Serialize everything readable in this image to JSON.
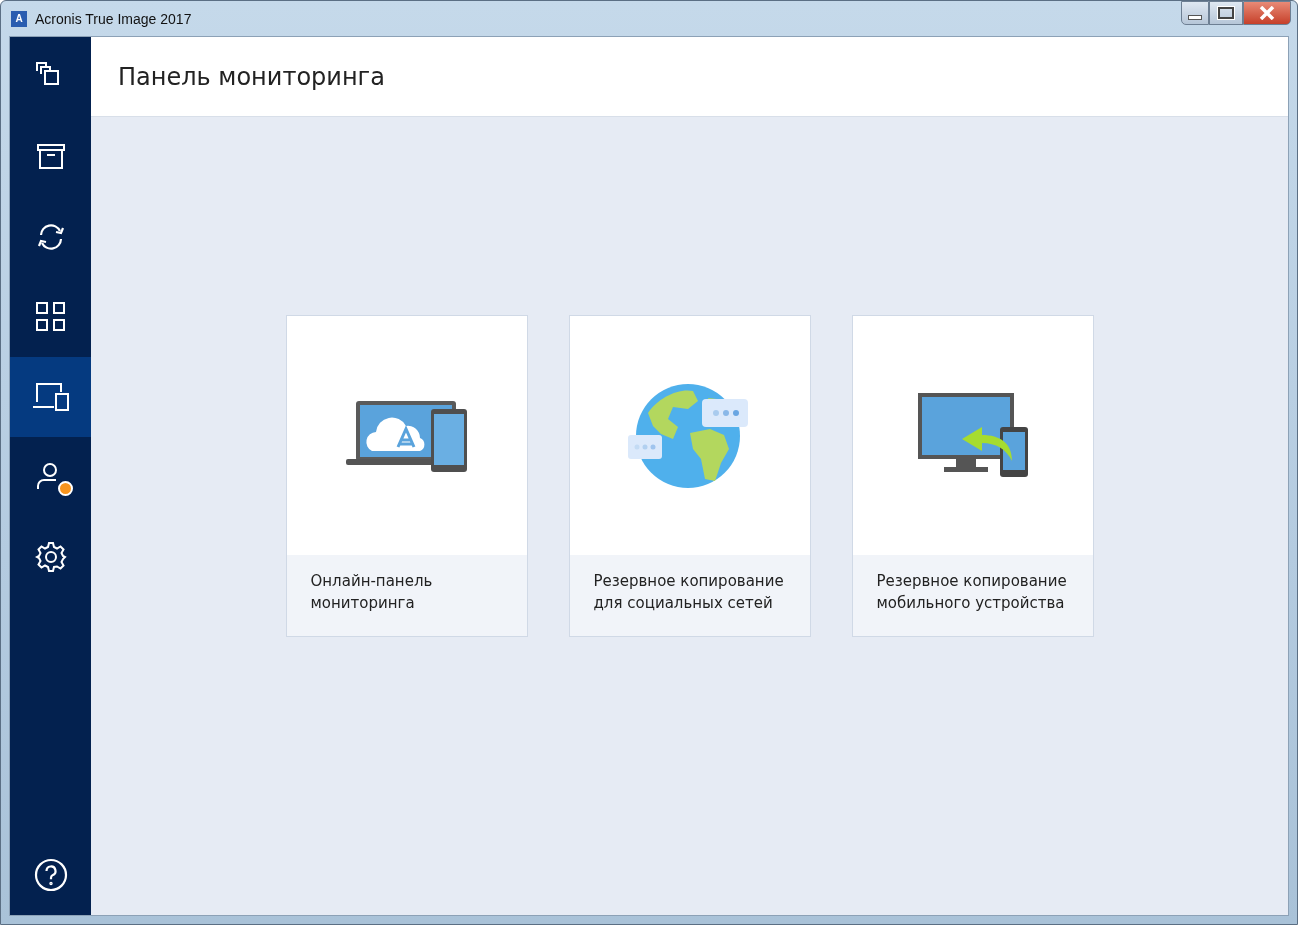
{
  "window": {
    "title": "Acronis True Image 2017",
    "icon_letter": "A"
  },
  "sidebar": {
    "items": [
      {
        "kind": "copies",
        "selected": false,
        "notification": false
      },
      {
        "kind": "archive",
        "selected": false,
        "notification": false
      },
      {
        "kind": "sync",
        "selected": false,
        "notification": false
      },
      {
        "kind": "grid",
        "selected": false,
        "notification": false
      },
      {
        "kind": "devices",
        "selected": true,
        "notification": false
      },
      {
        "kind": "account",
        "selected": false,
        "notification": true
      },
      {
        "kind": "settings",
        "selected": false,
        "notification": false
      }
    ],
    "bottom_item": {
      "kind": "help",
      "selected": false
    }
  },
  "header": {
    "title": "Панель мониторинга"
  },
  "cards": [
    {
      "kind": "laptop",
      "lines": [
        "Онлайн-панель",
        "мониторинга"
      ]
    },
    {
      "kind": "globe",
      "lines": [
        "Резервное копирование",
        "для социальных сетей"
      ]
    },
    {
      "kind": "mobile",
      "lines": [
        "Резервное копирование",
        "мобильного устройства"
      ]
    }
  ]
}
